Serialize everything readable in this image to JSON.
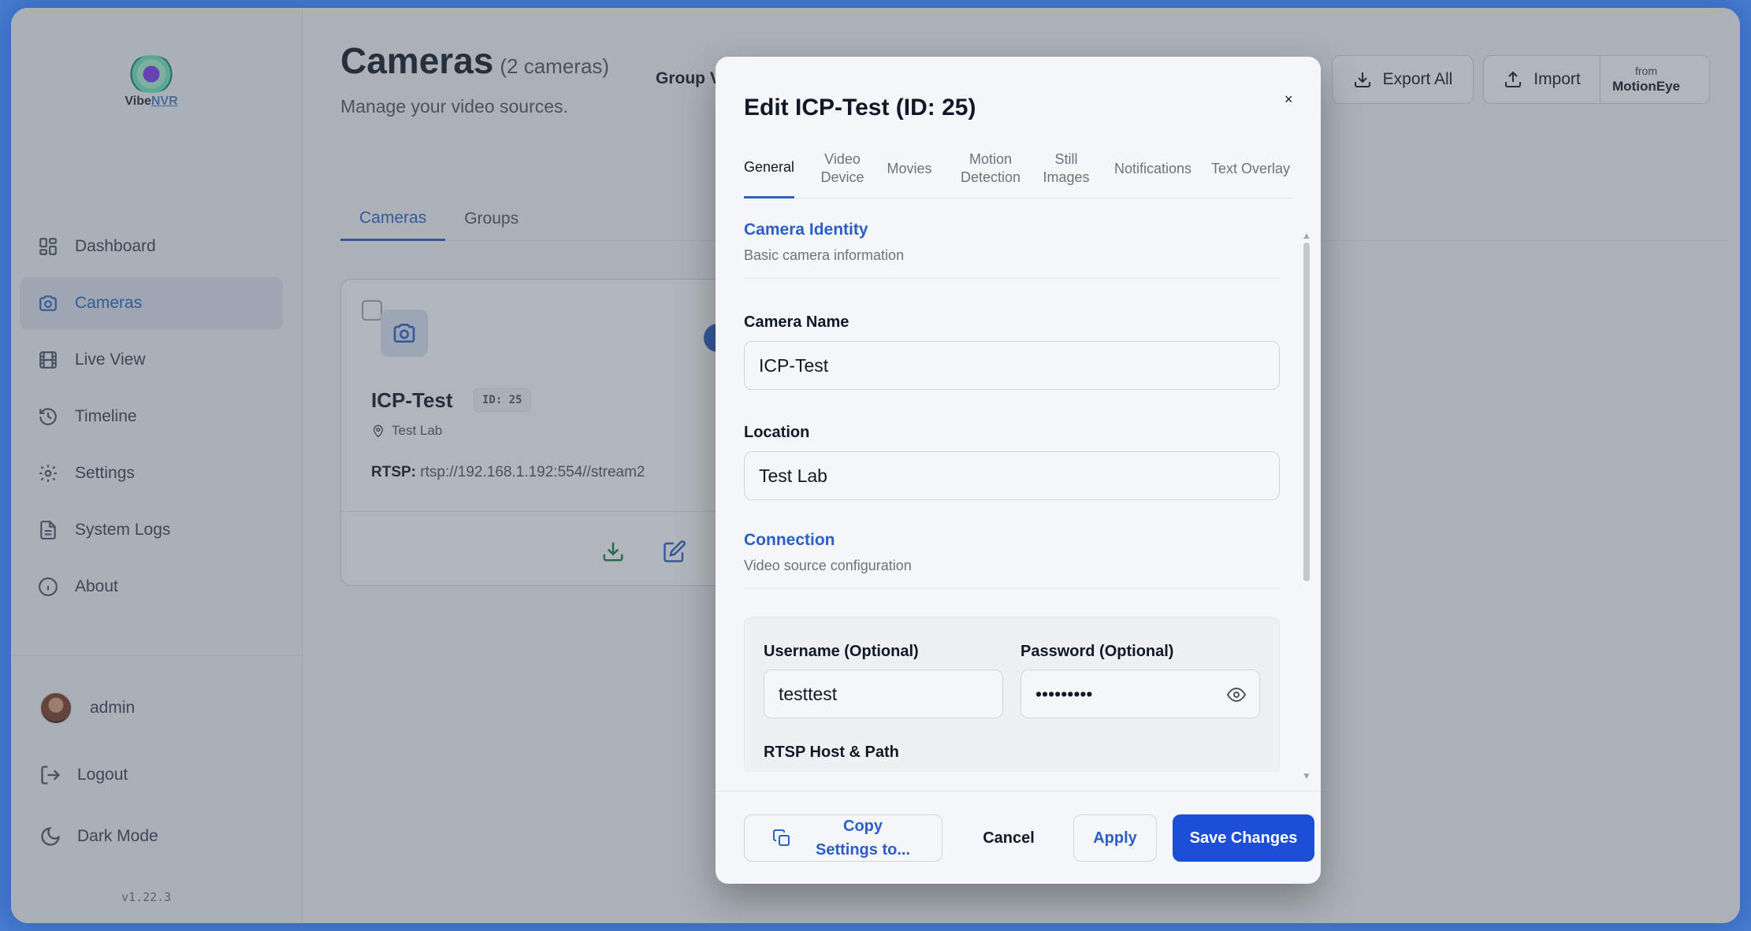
{
  "app": {
    "logo_text_a": "Vibe",
    "logo_text_b": "NVR",
    "version": "v1.22.3"
  },
  "sidebar": {
    "items": [
      {
        "label": "Dashboard",
        "icon": "dashboard-icon"
      },
      {
        "label": "Cameras",
        "icon": "camera-icon",
        "active": true
      },
      {
        "label": "Live View",
        "icon": "film-icon"
      },
      {
        "label": "Timeline",
        "icon": "history-icon"
      },
      {
        "label": "Settings",
        "icon": "gear-icon"
      },
      {
        "label": "System Logs",
        "icon": "document-icon"
      },
      {
        "label": "About",
        "icon": "info-icon"
      }
    ],
    "user": "admin",
    "logout": "Logout",
    "dark_mode": "Dark Mode"
  },
  "header": {
    "title": "Cameras",
    "count": "(2 cameras)",
    "subtitle": "Manage your video sources.",
    "group_label": "Group V",
    "export_all": "Export All",
    "import": "Import",
    "from": "from",
    "motioneye": "MotionEye"
  },
  "main_tabs": [
    "Cameras",
    "Groups"
  ],
  "card": {
    "name": "ICP-Test",
    "id": "ID: 25",
    "location": "Test Lab",
    "rtsp_label": "RTSP:",
    "rtsp_url": "rtsp://192.168.1.192:554//stream2"
  },
  "modal": {
    "title": "Edit ICP-Test (ID: 25)",
    "close": "×",
    "tabs": [
      "General",
      "Video Device",
      "Movies",
      "Motion Detection",
      "Still Images",
      "Notifications",
      "Text Overlay"
    ],
    "identity_title": "Camera Identity",
    "identity_sub": "Basic camera information",
    "camera_name_label": "Camera Name",
    "camera_name_value": "ICP-Test",
    "location_label": "Location",
    "location_value": "Test Lab",
    "connection_title": "Connection",
    "connection_sub": "Video source configuration",
    "username_label": "Username (Optional)",
    "username_value": "testtest",
    "password_label": "Password (Optional)",
    "password_value": "•••••••••",
    "rtsp_host_label": "RTSP Host & Path",
    "copy_settings": "Copy Settings to...",
    "cancel": "Cancel",
    "apply": "Apply",
    "save": "Save Changes"
  },
  "colors": {
    "accent": "#2b5fc7",
    "save_button": "#1d4ed8",
    "download_icon": "#15803d"
  }
}
